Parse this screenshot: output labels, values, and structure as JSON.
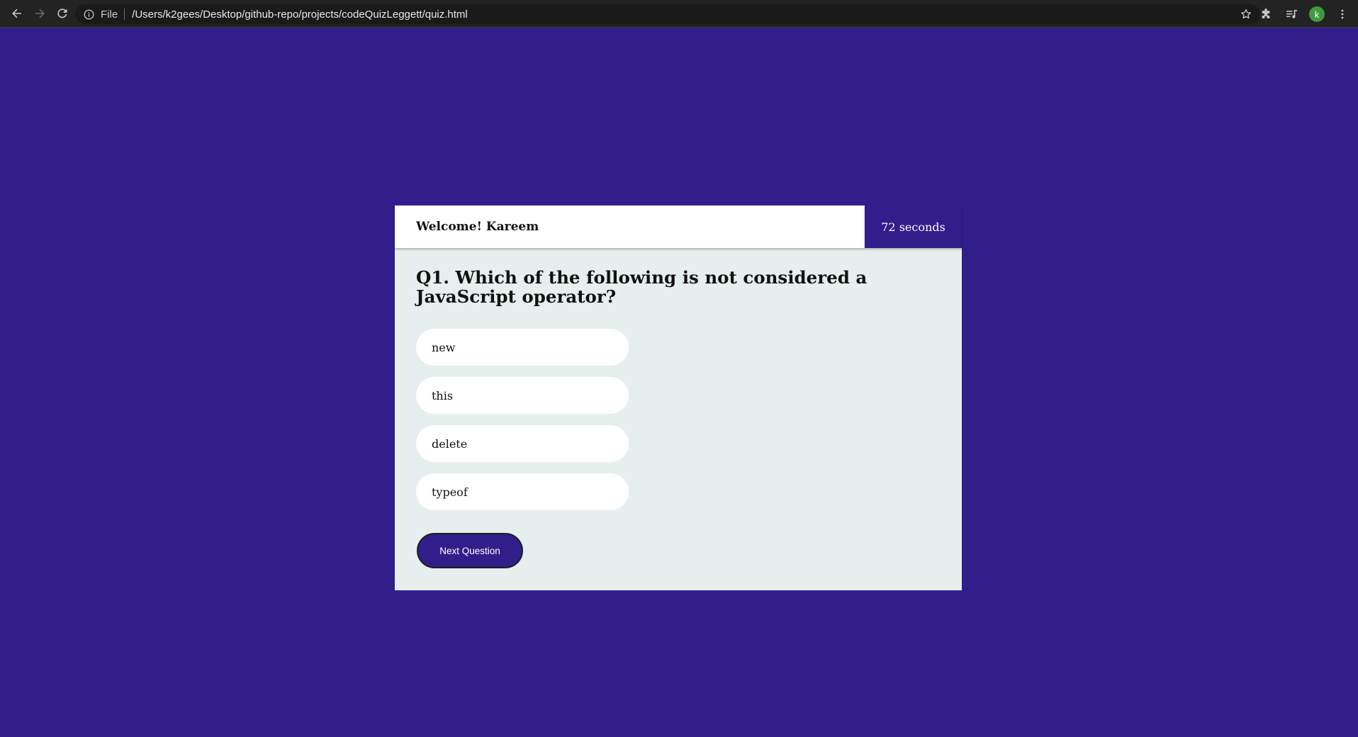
{
  "browser": {
    "back_icon": "arrow-left-icon",
    "forward_icon": "arrow-right-icon",
    "reload_icon": "reload-icon",
    "info_icon": "info-icon",
    "scheme_label": "File",
    "url": "/Users/k2gees/Desktop/github-repo/projects/codeQuizLeggett/quiz.html",
    "bookmark_icon": "star-icon",
    "extensions_icon": "puzzle-icon",
    "media_icon": "media-queue-icon",
    "profile_initial": "k",
    "menu_icon": "kebab-menu-icon"
  },
  "quiz": {
    "welcome": "Welcome! Kareem",
    "timer": "72 seconds",
    "question": "Q1. Which of the following is not considered a JavaScript operator?",
    "answers": [
      "new",
      "this",
      "delete",
      "typeof"
    ],
    "next_label": "Next Question"
  },
  "colors": {
    "page_background": "#311e8a",
    "card_background": "#e7eeee",
    "answer_background": "#ffffff",
    "button_background": "#311e8a",
    "profile_avatar": "#3f9a3f"
  }
}
